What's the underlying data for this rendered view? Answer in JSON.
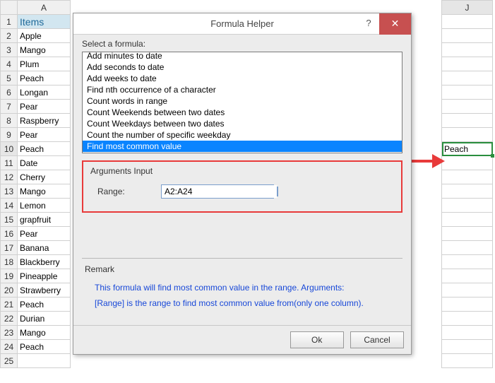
{
  "grid": {
    "colA_header": "A",
    "colJ_header": "J",
    "items_title": "Items",
    "rows": [
      "Apple",
      "Mango",
      "Plum",
      "Peach",
      "Longan",
      "Pear",
      "Raspberry",
      "Pear",
      "Peach",
      "Date",
      "Cherry",
      "Mango",
      "Lemon",
      "grapfruit",
      "Pear",
      "Banana",
      "Blackberry",
      "Pineapple",
      "Strawberry",
      "Peach",
      "Durian",
      "Mango",
      "Peach"
    ],
    "row_numbers": [
      1,
      2,
      3,
      4,
      5,
      6,
      7,
      8,
      9,
      10,
      11,
      12,
      13,
      14,
      15,
      16,
      17,
      18,
      19,
      20,
      21,
      22,
      23,
      24,
      25
    ],
    "result_cell": "Peach",
    "selected_row": 10
  },
  "dialog": {
    "title": "Formula Helper",
    "help": "?",
    "close": "✕",
    "select_label": "Select a formula:",
    "formulas": [
      "Add minutes to date",
      "Add seconds to date",
      "Add weeks to date",
      "Find nth occurrence of a character",
      "Count words in range",
      "Count Weekends between two dates",
      "Count Weekdays between two dates",
      "Count the number of specific weekday",
      "Find most common value"
    ],
    "selected_formula": "Find most common value",
    "args": {
      "title": "Arguments Input",
      "range_label": "Range:",
      "range_value": "A2:A24"
    },
    "remark": {
      "title": "Remark",
      "line1": "This formula will find most common value in the range. Arguments:",
      "line2": "[Range] is the range to find most common value from(only one column)."
    },
    "buttons": {
      "ok": "Ok",
      "cancel": "Cancel"
    }
  }
}
